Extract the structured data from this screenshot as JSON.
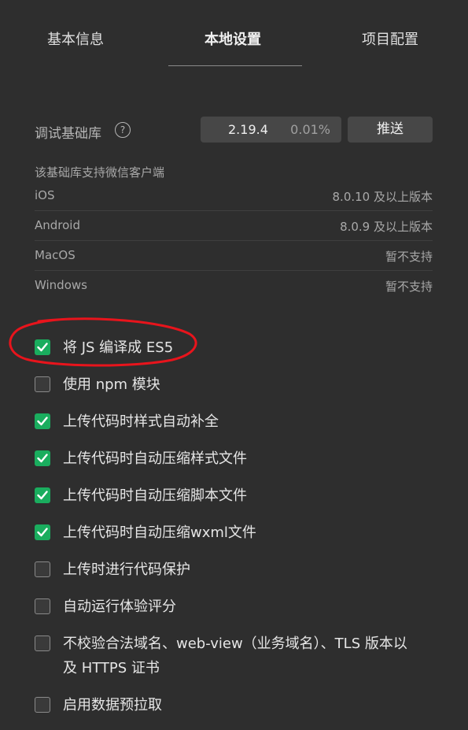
{
  "tabs": [
    {
      "label": "基本信息",
      "active": false
    },
    {
      "label": "本地设置",
      "active": true
    },
    {
      "label": "项目配置",
      "active": false
    }
  ],
  "sdk": {
    "label": "调试基础库",
    "help_icon": "?",
    "version": "2.19.4",
    "percent": "0.01%",
    "push_label": "推送"
  },
  "support": {
    "title": "该基础库支持微信客户端",
    "rows": [
      {
        "os": "iOS",
        "version": "8.0.10 及以上版本"
      },
      {
        "os": "Android",
        "version": "8.0.9 及以上版本"
      },
      {
        "os": "MacOS",
        "version": "暂不支持"
      },
      {
        "os": "Windows",
        "version": "暂不支持"
      }
    ]
  },
  "options": [
    {
      "label": "将 JS 编译成 ES5",
      "checked": true
    },
    {
      "label": "使用 npm 模块",
      "checked": false
    },
    {
      "label": "上传代码时样式自动补全",
      "checked": true
    },
    {
      "label": "上传代码时自动压缩样式文件",
      "checked": true
    },
    {
      "label": "上传代码时自动压缩脚本文件",
      "checked": true
    },
    {
      "label": "上传代码时自动压缩wxml文件",
      "checked": true
    },
    {
      "label": "上传时进行代码保护",
      "checked": false
    },
    {
      "label": "自动运行体验评分",
      "checked": false
    },
    {
      "label": "不校验合法域名、web-view（业务域名）、TLS 版本以及 HTTPS 证书",
      "checked": false
    },
    {
      "label": "启用数据预拉取",
      "checked": false
    }
  ],
  "colors": {
    "checked": "#1aad5e",
    "annotation": "#e8141c",
    "background": "#2e2e2e"
  }
}
